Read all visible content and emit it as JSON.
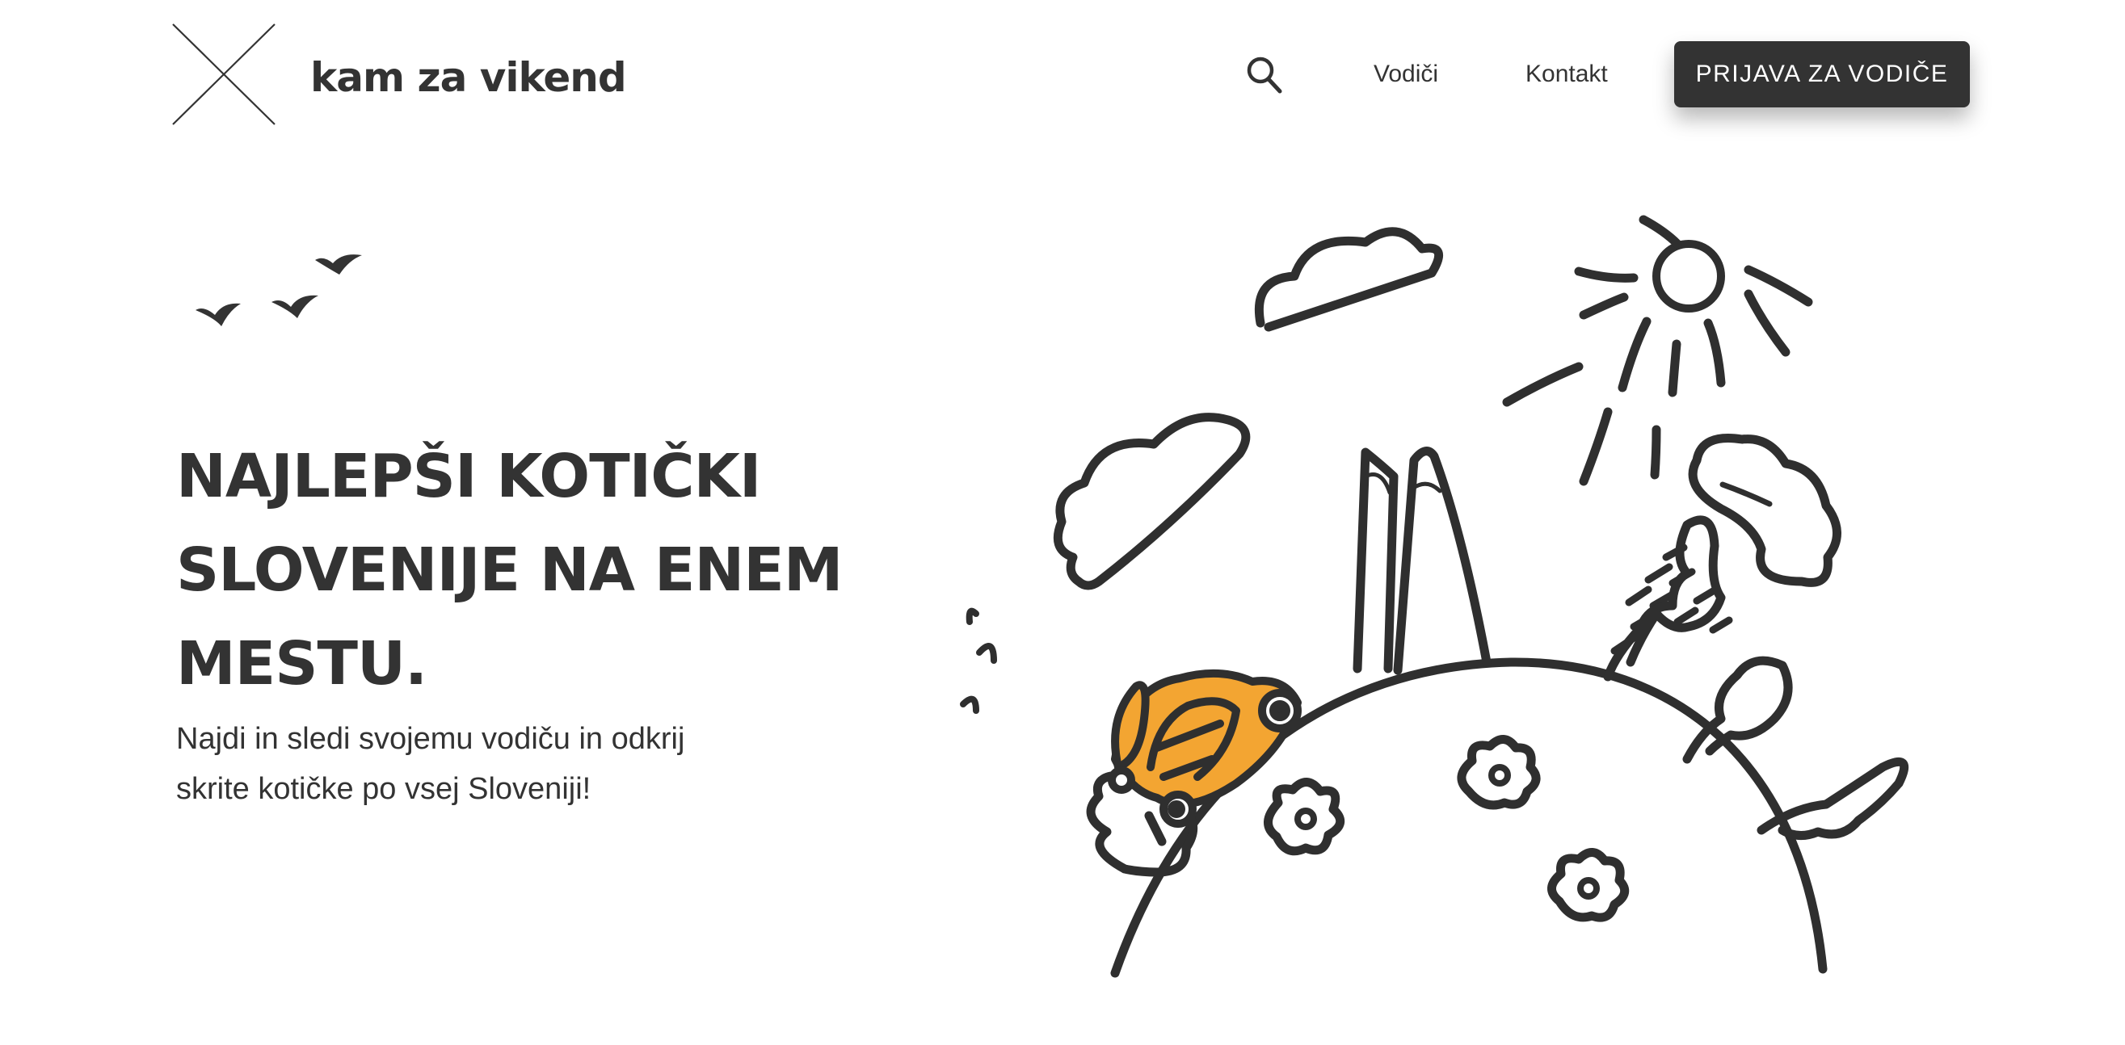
{
  "header": {
    "logo_text": "kam za vikend",
    "logo_icon": "cross-logo-icon",
    "search_icon": "search-icon",
    "nav": [
      {
        "label": "Vodiči"
      },
      {
        "label": "Kontakt"
      }
    ],
    "cta_label": "PRIJAVA ZA VODIČE"
  },
  "hero": {
    "headline_lines": [
      "NAJLEPŠI KOTIČKI",
      "SLOVENIJE NA ENEM",
      "MESTU."
    ],
    "subtitle_lines": [
      "Najdi in sledi svojemu vodiču in odkrij",
      "skrite kotičke po vsej Sloveniji!"
    ],
    "illustration": "hill-car-sun-mountains-illustration",
    "birds_icon": "birds-icon"
  },
  "colors": {
    "text": "#333333",
    "accent": "#f3a532",
    "button_bg": "#333333",
    "button_text": "#ffffff",
    "background": "#ffffff"
  }
}
